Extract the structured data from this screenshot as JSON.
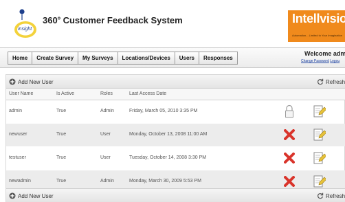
{
  "header": {
    "app_title": "360",
    "app_title_degree": "o",
    "app_title_rest": " Customer Feedback System",
    "logo_text": "insight",
    "brand_name": "Intellvisions",
    "brand_tagline": "Automation... Limited to Your Imagination",
    "brand_color": "#f08a1c"
  },
  "nav": {
    "tabs": [
      "Home",
      "Create Survey",
      "My Surveys",
      "Locations/Devices",
      "Users",
      "Responses"
    ],
    "welcome_text": "Welcome admi",
    "change_password": "Change Password",
    "logout": "Logou"
  },
  "grid": {
    "add_label": "Add New User",
    "refresh_label": "Refresh",
    "columns": [
      "User Name",
      "Is Active",
      "Roles",
      "Last Access Date"
    ],
    "rows": [
      {
        "user": "admin",
        "active": "True",
        "role": "Admin",
        "last_access": "Friday, March 05, 2010 3:35 PM",
        "status_icon": "lock-icon"
      },
      {
        "user": "newuser",
        "active": "True",
        "role": "User",
        "last_access": "Monday, October 13, 2008 11:00 AM",
        "status_icon": "delete-icon"
      },
      {
        "user": "testuser",
        "active": "True",
        "role": "User",
        "last_access": "Tuesday, October 14, 2008 3:30 PM",
        "status_icon": "delete-icon"
      },
      {
        "user": "newadmin",
        "active": "True",
        "role": "Admin",
        "last_access": "Monday, March 30, 2009 5:53 PM",
        "status_icon": "delete-icon"
      }
    ],
    "delete_color": "#d9342b",
    "edit_color": "#e7c23a"
  }
}
